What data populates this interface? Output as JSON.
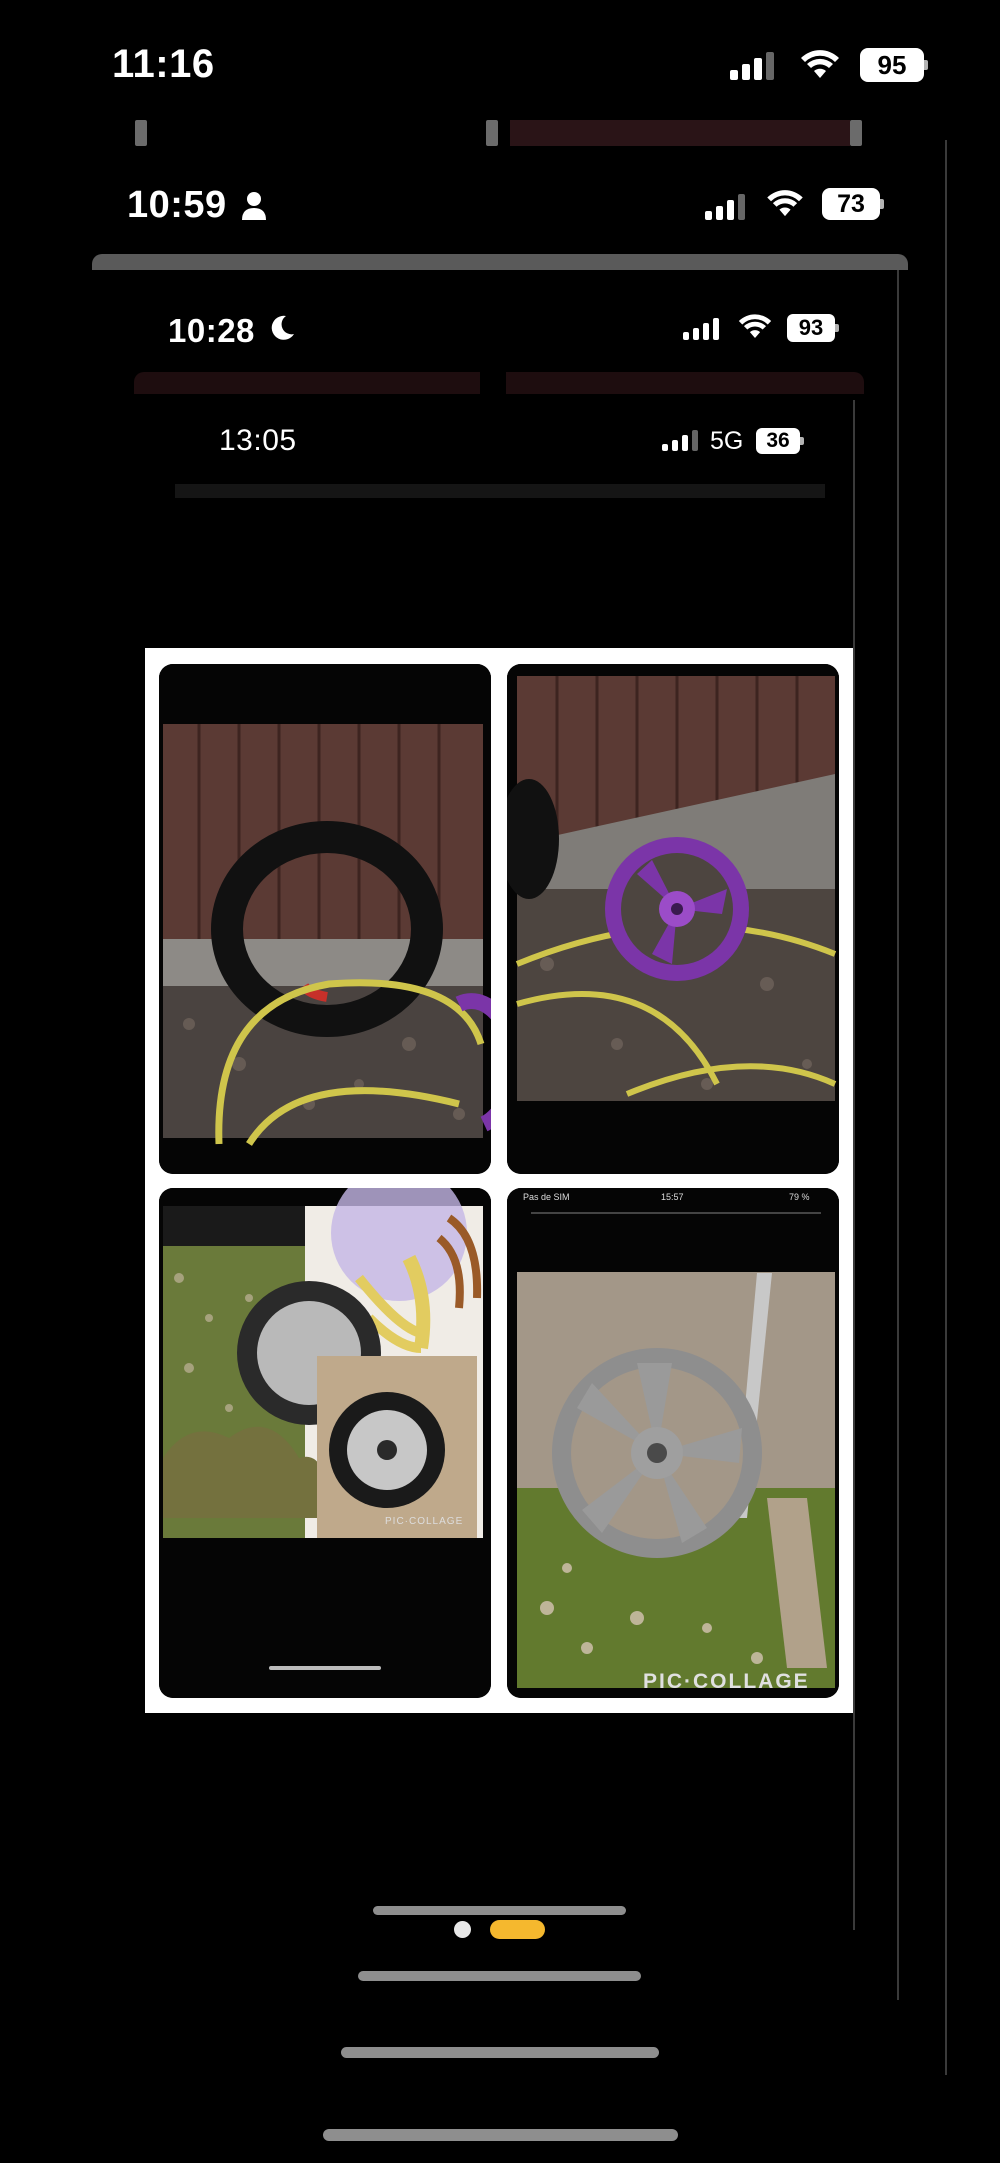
{
  "layers": [
    {
      "time": "11:16",
      "battery": "95",
      "person": false,
      "moon": false,
      "network": ""
    },
    {
      "time": "10:59",
      "battery": "73",
      "person": true,
      "moon": false,
      "network": ""
    },
    {
      "time": "10:28",
      "battery": "93",
      "person": false,
      "moon": true,
      "network": ""
    },
    {
      "time": "13:05",
      "battery": "36",
      "person": false,
      "moon": false,
      "network": "5G"
    }
  ],
  "collage": {
    "tiles": [
      {
        "name": "black-tire",
        "desc_icon": "tire-photo"
      },
      {
        "name": "purple-wheel",
        "desc_icon": "purple-wheel-photo"
      },
      {
        "name": "silver-wheel-collage",
        "desc_icon": "collage-photo"
      },
      {
        "name": "grey-wheel",
        "desc_icon": "grey-wheel-photo"
      }
    ],
    "inner_status_left": "Pas de SIM",
    "inner_status_time": "15:57",
    "inner_status_right": "79 %",
    "watermark_1": "PIC·COLLAGE",
    "watermark_2": "PIC·COLLAGE"
  },
  "page_dots": {
    "count": 2,
    "active": 1
  },
  "colors": {
    "accent_dot": "#f5b82e",
    "background": "#000000"
  }
}
